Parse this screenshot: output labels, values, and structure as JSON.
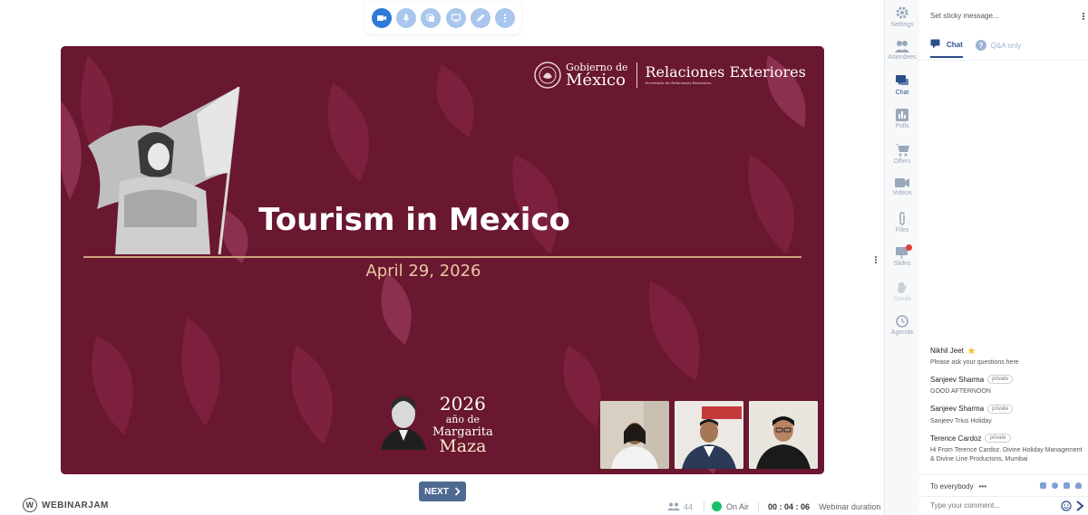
{
  "toolbar": {
    "buttons": [
      "camera-icon",
      "microphone-icon",
      "share-screen-icon",
      "monitor-icon",
      "pen-icon",
      "more-icon"
    ]
  },
  "slide": {
    "title": "Tourism in Mexico",
    "date": "April 29, 2026",
    "logo_small": "Gobierno de",
    "logo_big": "México",
    "ministry": "Relaciones Exteriores",
    "ministry_sub": "Secretaría de Relaciones Exteriores",
    "badge_year": "2026",
    "badge_line": "año de",
    "badge_first": "Margarita",
    "badge_last": "Maza"
  },
  "next_button": "NEXT",
  "brand": "WEBINARJAM",
  "stats": {
    "attendees": "44",
    "status": "On Air",
    "timer": "00 : 04 : 06",
    "timer_label": "Webinar duration"
  },
  "side_nav": [
    {
      "label": "Settings",
      "icon": "gear-icon",
      "state": "normal"
    },
    {
      "label": "Attendees",
      "icon": "people-icon",
      "state": "normal"
    },
    {
      "label": "Chat",
      "icon": "chat-icon",
      "state": "active"
    },
    {
      "label": "Polls",
      "icon": "poll-icon",
      "state": "normal"
    },
    {
      "label": "Offers",
      "icon": "cart-icon",
      "state": "normal"
    },
    {
      "label": "Videos",
      "icon": "video-icon",
      "state": "normal"
    },
    {
      "label": "Files",
      "icon": "paperclip-icon",
      "state": "normal"
    },
    {
      "label": "Slides",
      "icon": "slides-icon",
      "state": "normal"
    },
    {
      "label": "Speak",
      "icon": "hand-icon",
      "state": "disabled"
    },
    {
      "label": "Agenda",
      "icon": "clock-icon",
      "state": "normal"
    }
  ],
  "chat": {
    "sticky_placeholder": "Set sticky message...",
    "tab_chat": "Chat",
    "tab_qa": "Q&A only",
    "messages": [
      {
        "author": "Nikhil Jeet",
        "badge": "",
        "text": "Please ask your questions here"
      },
      {
        "author": "Sanjeev Sharma",
        "badge": "private",
        "text": "GOOD AFTERNOON"
      },
      {
        "author": "Sanjeev Sharma",
        "badge": "private",
        "text": "Sanjeev Trius Holiday"
      },
      {
        "author": "Terence Cardoz",
        "badge": "private",
        "text": "Hi From Terence Cardoz. Divine Holiday Management & Divine Line Productons, Mumbai"
      }
    ],
    "to_label": "To everybody",
    "to_more": "•••",
    "input_placeholder": "Type your comment..."
  },
  "colors": {
    "slide_bg": "#6a1730",
    "accent": "#2f7ad6",
    "on_air": "#15c26b",
    "next_button": "#4f6a91"
  }
}
